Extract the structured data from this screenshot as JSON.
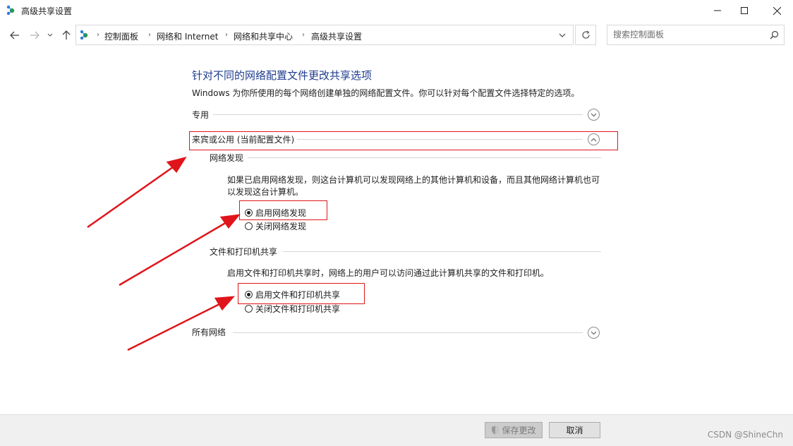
{
  "window": {
    "title": "高级共享设置"
  },
  "breadcrumb": [
    "控制面板",
    "网络和 Internet",
    "网络和共享中心",
    "高级共享设置"
  ],
  "search": {
    "placeholder": "搜索控制面板"
  },
  "page": {
    "title": "针对不同的网络配置文件更改共享选项",
    "description": "Windows 为你所使用的每个网络创建单独的网络配置文件。你可以针对每个配置文件选择特定的选项。"
  },
  "profiles": {
    "private": {
      "label": "专用"
    },
    "guest_public": {
      "label": "来宾或公用 (当前配置文件)",
      "network_discovery": {
        "header": "网络发现",
        "text": "如果已启用网络发现，则这台计算机可以发现网络上的其他计算机和设备，而且其他网络计算机也可以发现这台计算机。",
        "options": [
          "启用网络发现",
          "关闭网络发现"
        ],
        "selected": "启用网络发现"
      },
      "file_printer_sharing": {
        "header": "文件和打印机共享",
        "text": "启用文件和打印机共享时，网络上的用户可以访问通过此计算机共享的文件和打印机。",
        "options": [
          "启用文件和打印机共享",
          "关闭文件和打印机共享"
        ],
        "selected": "启用文件和打印机共享"
      }
    },
    "all_networks": {
      "label": "所有网络"
    }
  },
  "footer": {
    "save_label": "保存更改",
    "cancel_label": "取消"
  },
  "watermark": "CSDN @ShineChn",
  "colors": {
    "title_blue": "#1e3c8c",
    "annotation_red": "#e0151b"
  }
}
